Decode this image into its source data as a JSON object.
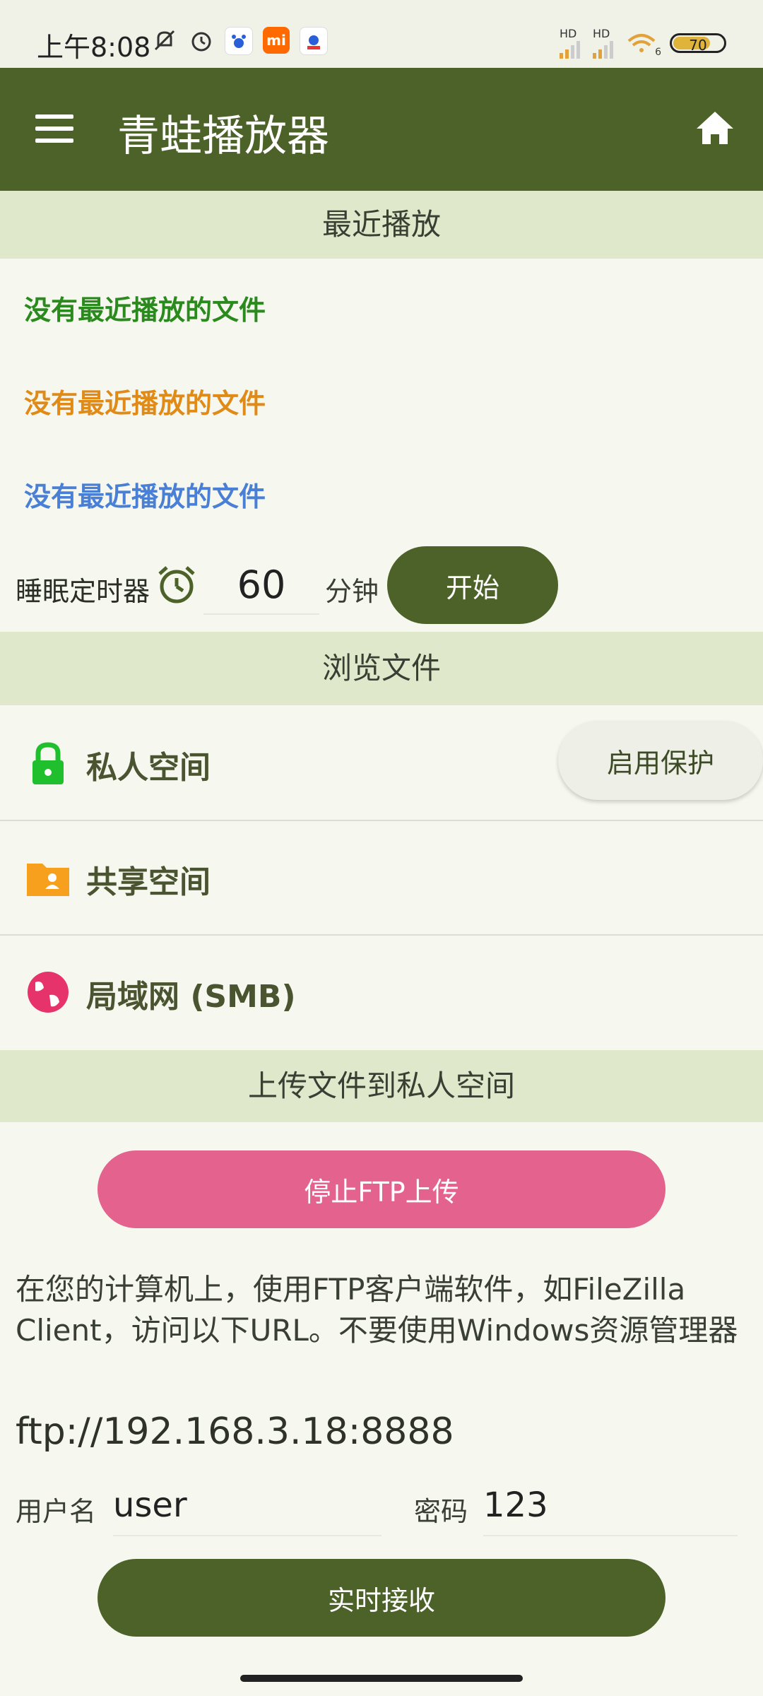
{
  "status_bar": {
    "time": "上午8:08",
    "battery": "70",
    "signal1": "HD",
    "signal2": "HD",
    "wifi_badge": "6"
  },
  "app_bar": {
    "title": "青蛙播放器"
  },
  "recent": {
    "header": "最近播放",
    "items": [
      {
        "text": "没有最近播放的文件",
        "color": "#2a8a1e"
      },
      {
        "text": "没有最近播放的文件",
        "color": "#e08a18"
      },
      {
        "text": "没有最近播放的文件",
        "color": "#4a7fd6"
      }
    ]
  },
  "sleep_timer": {
    "label": "睡眠定时器",
    "minutes": "60",
    "unit": "分钟",
    "start_label": "开始"
  },
  "browse": {
    "header": "浏览文件",
    "private": "私人空间",
    "protect_label": "启用保护",
    "shared": "共享空间",
    "lan": "局域网 (SMB)"
  },
  "upload": {
    "header": "上传文件到私人空间",
    "stop_label": "停止FTP上传",
    "info": "在您的计算机上，使用FTP客户端软件，如FileZilla Client，访问以下URL。不要使用Windows资源管理器",
    "url": "ftp://192.168.3.18:8888",
    "username_label": "用户名",
    "username": "user",
    "password_label": "密码",
    "password": "123",
    "receive_label": "实时接收"
  },
  "colors": {
    "primary": "#4d6229",
    "section_bg": "#dfe8cb",
    "ftp_button": "#e3628e",
    "lock": "#1fbf2e",
    "folder": "#f7a01e",
    "globe": "#e6336c"
  }
}
